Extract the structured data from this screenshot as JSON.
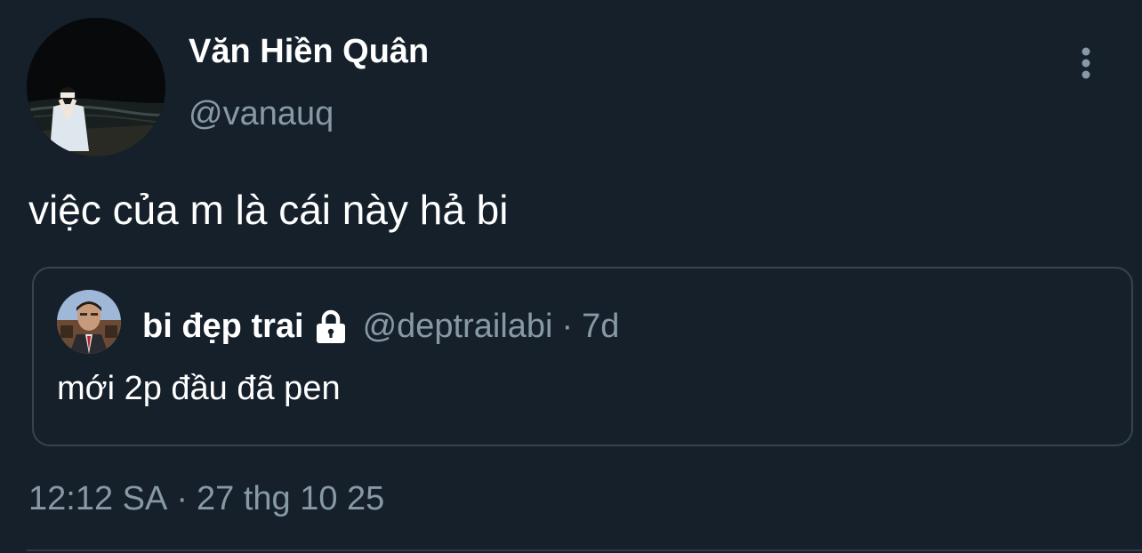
{
  "tweet": {
    "author": {
      "display_name": "Văn Hiền Quân",
      "handle": "@vanauq"
    },
    "text": "việc của m là cái này hả bi",
    "timestamp": {
      "time": "12:12 SA",
      "separator": "·",
      "date": "27 thg 10 25"
    },
    "menu_icon": "more-vertical-icon"
  },
  "quoted_tweet": {
    "author": {
      "display_name": "bi đẹp trai",
      "handle": "@deptrailabi",
      "protected_icon": "lock-icon"
    },
    "separator": "·",
    "relative_time": "7d",
    "text": "mới 2p đầu đã pen"
  },
  "colors": {
    "background": "#15202b",
    "primary_text": "#ffffff",
    "secondary_text": "#8899a6",
    "border": "#38444d"
  }
}
